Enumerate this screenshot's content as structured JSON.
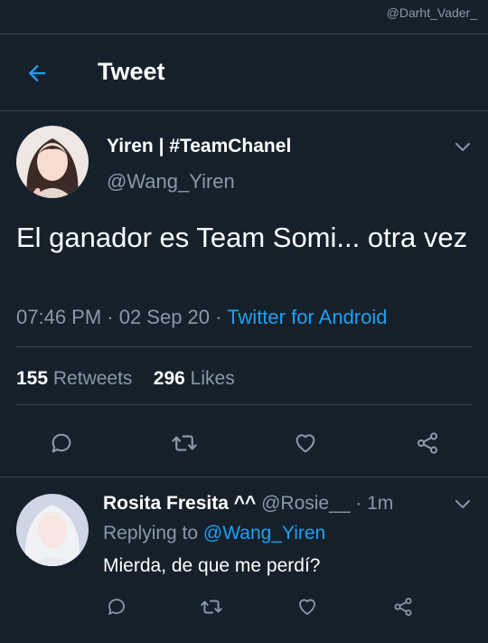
{
  "watermark": "@Darht_Vader_",
  "header": {
    "title": "Tweet"
  },
  "tweet": {
    "name": "Yiren | #TeamChanel",
    "handle": "@Wang_Yiren",
    "text": "El ganador es Team Somi... otra vez",
    "time": "07:46 PM · 02 Sep 20 · ",
    "source": "Twitter for Android",
    "retweet_count": "155",
    "retweet_label": "Retweets",
    "like_count": "296",
    "like_label": "Likes"
  },
  "reply": {
    "name": "Rosita Fresita ^^",
    "handle_time": "@Rosie__ · 1m",
    "replying_prefix": "Replying to ",
    "replying_to": "@Wang_Yiren",
    "text": "Mierda, de que me perdí?"
  },
  "colors": {
    "background": "#15202b",
    "accent": "#1da1f2",
    "muted": "#8899a6",
    "divider": "#38444d"
  }
}
